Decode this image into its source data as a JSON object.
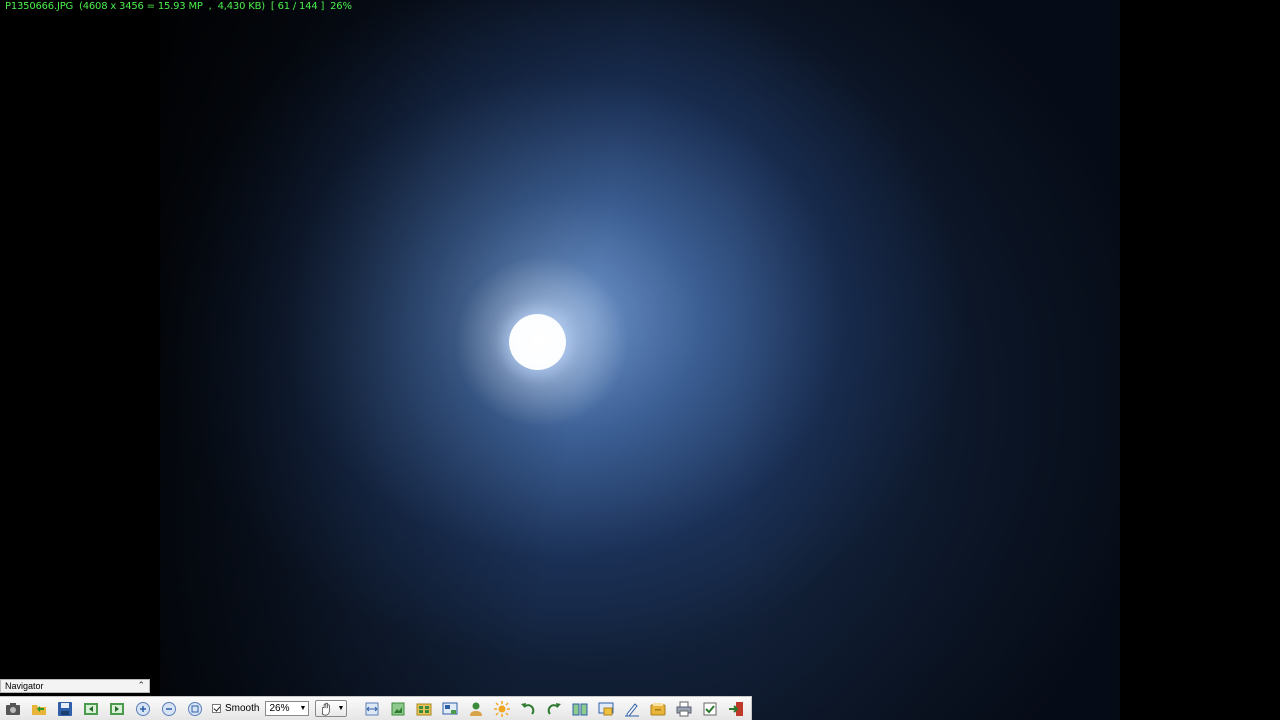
{
  "window": {
    "file_info": "P1350666.JPG  (4608 x 3456 = 15.93 MP  ,  4,430 KB)  [ 61 / 144 ]  26%"
  },
  "navigator": {
    "title": "Navigator",
    "collapse_icon": "double-chevron-up-icon"
  },
  "toolbar": {
    "smooth_label": "Smooth",
    "smooth_checked": true,
    "zoom_value": "26%",
    "icons": [
      "screenshot-camera-icon",
      "open-folder-icon",
      "save-icon",
      "previous-image-icon",
      "next-image-icon",
      "zoom-in-icon",
      "zoom-out-icon",
      "original-size-icon",
      "hand-tool-icon",
      "fit-width-icon",
      "fit-image-icon",
      "thumbnails-icon",
      "slideshow-icon",
      "user-contact-icon",
      "brightness-sun-icon",
      "rotate-left-icon",
      "rotate-right-icon",
      "compare-icon",
      "screen-fit-icon",
      "edit-icon",
      "open-drawer-icon",
      "print-icon",
      "properties-icon",
      "exit-icon"
    ]
  },
  "colors": {
    "info_text": "#4cf04c",
    "background": "#000000",
    "sky_light": "#78a0d7",
    "sky_dark": "#0b1424"
  }
}
